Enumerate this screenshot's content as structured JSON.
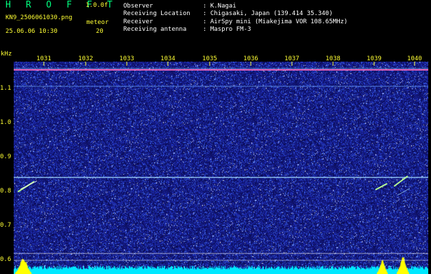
{
  "header": {
    "app_title": "H R O F F T",
    "version": "1.0.0f",
    "filename": "KN9_2506061030.png",
    "datetime": "25.06.06 10:30",
    "meteor_label": "meteor",
    "meteor_count": "20"
  },
  "info": [
    {
      "key": "Observer",
      "value": ": K.Nagai"
    },
    {
      "key": "Receiving Location",
      "value": ": Chigasaki, Japan (139.414 35.340)"
    },
    {
      "key": "Receiver",
      "value": ": AirSpy mini (Miakejima VOR 108.65MHz)"
    },
    {
      "key": "Receiving antenna",
      "value": ": Maspro FM-3"
    }
  ],
  "axis": {
    "y_unit": "kHz",
    "y_ticks": [
      "1.1",
      "1.0",
      "0.9",
      "0.8",
      "0.7",
      "0.6"
    ],
    "x_ticks": [
      "1031",
      "1032",
      "1033",
      "1034",
      "1035",
      "1036",
      "1037",
      "1038",
      "1039",
      "1040"
    ]
  },
  "colors": {
    "background": "#000000",
    "label_yellow": "#ffff33",
    "title_green": "#00ff7f",
    "spectrogram_base": "#14187a",
    "noise_bright": "#3a6cff",
    "signal_line": "#9fd8ff",
    "carrier_line": "#ff6ac0",
    "meteor_echo": "#b8ff90",
    "spectrum_cyan": "#00e8ff",
    "spectrum_yellow": "#ffff00"
  }
}
